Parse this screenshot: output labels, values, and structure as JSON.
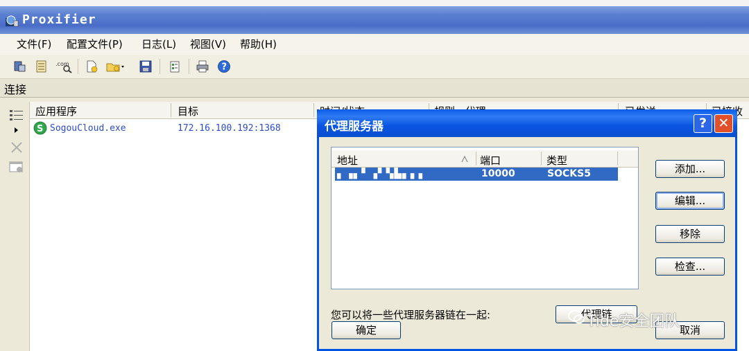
{
  "window": {
    "title": "Proxifier",
    "menu": [
      "文件(F)",
      "配置文件(P)",
      "日志(L)",
      "视图(V)",
      "帮助(H)"
    ],
    "toolbar_icons": [
      "proxy-servers-icon",
      "rules-icon",
      "name-resolution-icon",
      "new-profile-icon",
      "open-profile-icon",
      "save-profile-icon",
      "options-icon",
      "print-icon",
      "help-icon"
    ]
  },
  "connections": {
    "title": "连接",
    "columns": [
      "应用程序",
      "目标",
      "时间/状态",
      "规则 : 代理",
      "已发送",
      "已接收"
    ],
    "rows": [
      {
        "app": "SogouCloud.exe",
        "target": "172.16.100.192:1368"
      }
    ]
  },
  "dialog": {
    "title": "代理服务器",
    "help_label": "?",
    "close_label": "✕",
    "columns": {
      "address": "地址",
      "port": "端口",
      "type": "类型"
    },
    "rows": [
      {
        "address": "▖▗▖▘▗▘▚▙▖▖▖",
        "port": "10000",
        "type": "SOCKS5"
      }
    ],
    "buttons": {
      "add": "添加...",
      "edit": "编辑...",
      "remove": "移除",
      "check": "检查...",
      "chain": "代理链",
      "ok": "确定",
      "cancel": "取消"
    },
    "chain_text": "您可以将一些代理服务器链在一起:"
  },
  "watermark": "Tide安全团队",
  "colors": {
    "title_blue": "#0054e3",
    "selection": "#316ac5",
    "link_blue": "#2a4bd0"
  }
}
